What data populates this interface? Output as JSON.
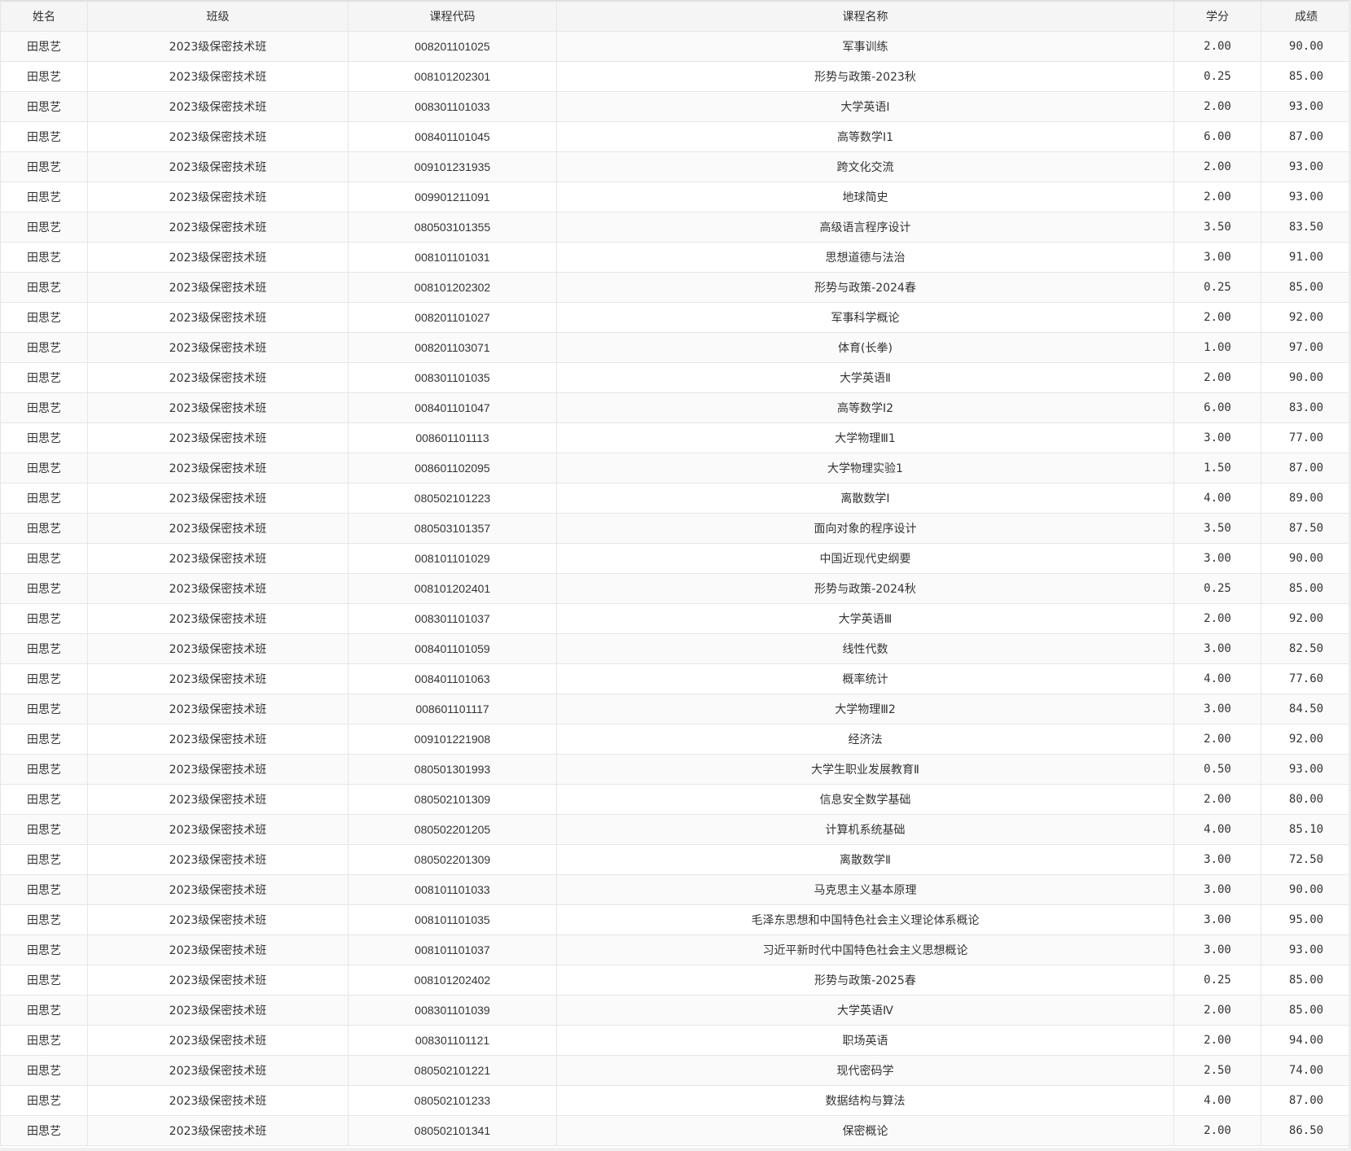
{
  "columns": [
    "姓名",
    "班级",
    "课程代码",
    "课程名称",
    "学分",
    "成绩"
  ],
  "rows": [
    [
      "田思艺",
      "2023级保密技术班",
      "008201101025",
      "军事训练",
      "2.00",
      "90.00"
    ],
    [
      "田思艺",
      "2023级保密技术班",
      "008101202301",
      "形势与政策-2023秋",
      "0.25",
      "85.00"
    ],
    [
      "田思艺",
      "2023级保密技术班",
      "008301101033",
      "大学英语Ⅰ",
      "2.00",
      "93.00"
    ],
    [
      "田思艺",
      "2023级保密技术班",
      "008401101045",
      "高等数学Ⅰ1",
      "6.00",
      "87.00"
    ],
    [
      "田思艺",
      "2023级保密技术班",
      "009101231935",
      "跨文化交流",
      "2.00",
      "93.00"
    ],
    [
      "田思艺",
      "2023级保密技术班",
      "009901211091",
      "地球简史",
      "2.00",
      "93.00"
    ],
    [
      "田思艺",
      "2023级保密技术班",
      "080503101355",
      "高级语言程序设计",
      "3.50",
      "83.50"
    ],
    [
      "田思艺",
      "2023级保密技术班",
      "008101101031",
      "思想道德与法治",
      "3.00",
      "91.00"
    ],
    [
      "田思艺",
      "2023级保密技术班",
      "008101202302",
      "形势与政策-2024春",
      "0.25",
      "85.00"
    ],
    [
      "田思艺",
      "2023级保密技术班",
      "008201101027",
      "军事科学概论",
      "2.00",
      "92.00"
    ],
    [
      "田思艺",
      "2023级保密技术班",
      "008201103071",
      "体育(长拳)",
      "1.00",
      "97.00"
    ],
    [
      "田思艺",
      "2023级保密技术班",
      "008301101035",
      "大学英语Ⅱ",
      "2.00",
      "90.00"
    ],
    [
      "田思艺",
      "2023级保密技术班",
      "008401101047",
      "高等数学Ⅰ2",
      "6.00",
      "83.00"
    ],
    [
      "田思艺",
      "2023级保密技术班",
      "008601101113",
      "大学物理Ⅲ1",
      "3.00",
      "77.00"
    ],
    [
      "田思艺",
      "2023级保密技术班",
      "008601102095",
      "大学物理实验1",
      "1.50",
      "87.00"
    ],
    [
      "田思艺",
      "2023级保密技术班",
      "080502101223",
      "离散数学Ⅰ",
      "4.00",
      "89.00"
    ],
    [
      "田思艺",
      "2023级保密技术班",
      "080503101357",
      "面向对象的程序设计",
      "3.50",
      "87.50"
    ],
    [
      "田思艺",
      "2023级保密技术班",
      "008101101029",
      "中国近现代史纲要",
      "3.00",
      "90.00"
    ],
    [
      "田思艺",
      "2023级保密技术班",
      "008101202401",
      "形势与政策-2024秋",
      "0.25",
      "85.00"
    ],
    [
      "田思艺",
      "2023级保密技术班",
      "008301101037",
      "大学英语Ⅲ",
      "2.00",
      "92.00"
    ],
    [
      "田思艺",
      "2023级保密技术班",
      "008401101059",
      "线性代数",
      "3.00",
      "82.50"
    ],
    [
      "田思艺",
      "2023级保密技术班",
      "008401101063",
      "概率统计",
      "4.00",
      "77.60"
    ],
    [
      "田思艺",
      "2023级保密技术班",
      "008601101117",
      "大学物理Ⅲ2",
      "3.00",
      "84.50"
    ],
    [
      "田思艺",
      "2023级保密技术班",
      "009101221908",
      "经济法",
      "2.00",
      "92.00"
    ],
    [
      "田思艺",
      "2023级保密技术班",
      "080501301993",
      "大学生职业发展教育Ⅱ",
      "0.50",
      "93.00"
    ],
    [
      "田思艺",
      "2023级保密技术班",
      "080502101309",
      "信息安全数学基础",
      "2.00",
      "80.00"
    ],
    [
      "田思艺",
      "2023级保密技术班",
      "080502201205",
      "计算机系统基础",
      "4.00",
      "85.10"
    ],
    [
      "田思艺",
      "2023级保密技术班",
      "080502201309",
      "离散数学Ⅱ",
      "3.00",
      "72.50"
    ],
    [
      "田思艺",
      "2023级保密技术班",
      "008101101033",
      "马克思主义基本原理",
      "3.00",
      "90.00"
    ],
    [
      "田思艺",
      "2023级保密技术班",
      "008101101035",
      "毛泽东思想和中国特色社会主义理论体系概论",
      "3.00",
      "95.00"
    ],
    [
      "田思艺",
      "2023级保密技术班",
      "008101101037",
      "习近平新时代中国特色社会主义思想概论",
      "3.00",
      "93.00"
    ],
    [
      "田思艺",
      "2023级保密技术班",
      "008101202402",
      "形势与政策-2025春",
      "0.25",
      "85.00"
    ],
    [
      "田思艺",
      "2023级保密技术班",
      "008301101039",
      "大学英语Ⅳ",
      "2.00",
      "85.00"
    ],
    [
      "田思艺",
      "2023级保密技术班",
      "008301101121",
      "职场英语",
      "2.00",
      "94.00"
    ],
    [
      "田思艺",
      "2023级保密技术班",
      "080502101221",
      "现代密码学",
      "2.50",
      "74.00"
    ],
    [
      "田思艺",
      "2023级保密技术班",
      "080502101233",
      "数据结构与算法",
      "4.00",
      "87.00"
    ],
    [
      "田思艺",
      "2023级保密技术班",
      "080502101341",
      "保密概论",
      "2.00",
      "86.50"
    ]
  ]
}
